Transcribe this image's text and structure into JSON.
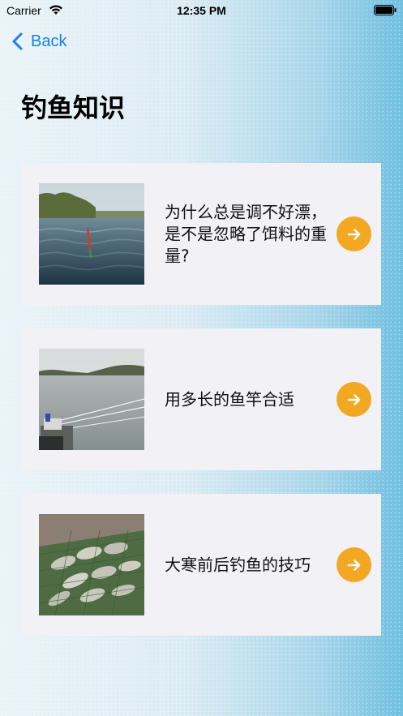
{
  "status_bar": {
    "carrier": "Carrier",
    "time": "12:35 PM",
    "wifi_icon": "wifi-icon",
    "battery_icon": "battery-icon"
  },
  "nav": {
    "back_label": "Back",
    "back_icon": "chevron-left-icon",
    "accent_color": "#1a7cf5"
  },
  "page": {
    "title": "钓鱼知识"
  },
  "articles": [
    {
      "title": "为什么总是调不好漂，是不是忽略了饵料的重量?",
      "thumbnail": "fishing-float-water-photo",
      "action_icon": "arrow-right-icon"
    },
    {
      "title": "用多长的鱼竿合适",
      "thumbnail": "lake-fishing-rods-photo",
      "action_icon": "arrow-right-icon"
    },
    {
      "title": "大寒前后钓鱼的技巧",
      "thumbnail": "fish-in-net-photo",
      "action_icon": "arrow-right-icon"
    }
  ],
  "colors": {
    "card_background": "#f2f1f6",
    "arrow_button": "#f3a823"
  }
}
